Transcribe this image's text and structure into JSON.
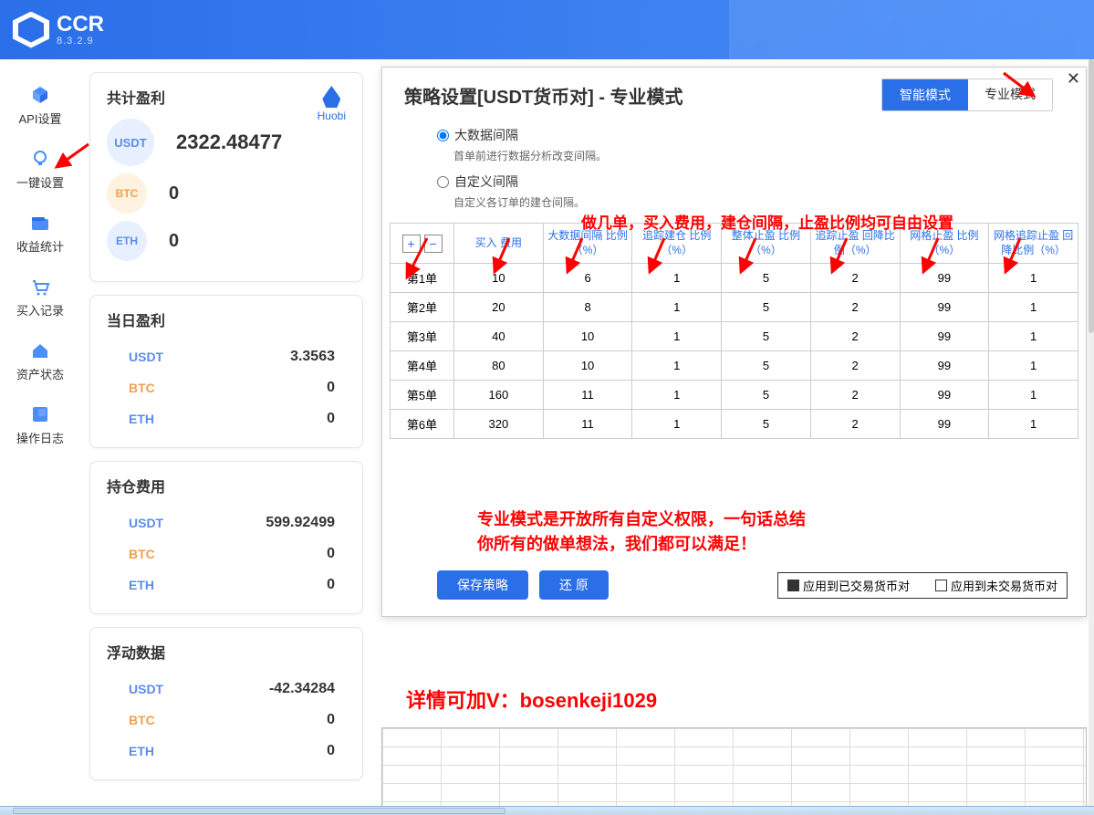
{
  "app": {
    "name": "CCR",
    "version": "8.3.2.9"
  },
  "sidebar": [
    {
      "label": "API设置",
      "icon": "api"
    },
    {
      "label": "一键设置",
      "icon": "bulb"
    },
    {
      "label": "收益统计",
      "icon": "folder"
    },
    {
      "label": "买入记录",
      "icon": "cart"
    },
    {
      "label": "资产状态",
      "icon": "home"
    },
    {
      "label": "操作日志",
      "icon": "list"
    }
  ],
  "exchange": "Huobi",
  "totals": {
    "title": "共计盈利",
    "rows": [
      {
        "coin": "USDT",
        "value": "2322.48477"
      },
      {
        "coin": "BTC",
        "value": "0"
      },
      {
        "coin": "ETH",
        "value": "0"
      }
    ]
  },
  "today": {
    "title": "当日盈利",
    "rows": [
      {
        "coin": "USDT",
        "value": "3.3563"
      },
      {
        "coin": "BTC",
        "value": "0"
      },
      {
        "coin": "ETH",
        "value": "0"
      }
    ]
  },
  "holding": {
    "title": "持仓费用",
    "rows": [
      {
        "coin": "USDT",
        "value": "599.92499"
      },
      {
        "coin": "BTC",
        "value": "0"
      },
      {
        "coin": "ETH",
        "value": "0"
      }
    ]
  },
  "floating": {
    "title": "浮动数据",
    "rows": [
      {
        "coin": "USDT",
        "value": "-42.34284"
      },
      {
        "coin": "BTC",
        "value": "0"
      },
      {
        "coin": "ETH",
        "value": "0"
      }
    ]
  },
  "dialog": {
    "title": "策略设置[USDT货币对] - 专业模式",
    "tabs": [
      "智能模式",
      "专业模式"
    ],
    "radio1": {
      "label": "大数据间隔",
      "desc": "首单前进行数据分析改变间隔。"
    },
    "radio2": {
      "label": "自定义间隔",
      "desc": "自定义各订单的建仓间隔。"
    },
    "headers": [
      "买入\n费用",
      "大数据间隔\n比例（%）",
      "追踪建仓\n比例（%）",
      "整体止盈\n比例（%）",
      "追踪止盈\n回降比例（%）",
      "网格止盈\n比例（%）",
      "网格追踪止盈\n回降比例（%）"
    ],
    "rows": [
      {
        "n": "第1单",
        "v": [
          "10",
          "6",
          "1",
          "5",
          "2",
          "99",
          "1"
        ]
      },
      {
        "n": "第2单",
        "v": [
          "20",
          "8",
          "1",
          "5",
          "2",
          "99",
          "1"
        ]
      },
      {
        "n": "第3单",
        "v": [
          "40",
          "10",
          "1",
          "5",
          "2",
          "99",
          "1"
        ]
      },
      {
        "n": "第4单",
        "v": [
          "80",
          "10",
          "1",
          "5",
          "2",
          "99",
          "1"
        ]
      },
      {
        "n": "第5单",
        "v": [
          "160",
          "11",
          "1",
          "5",
          "2",
          "99",
          "1"
        ]
      },
      {
        "n": "第6单",
        "v": [
          "320",
          "11",
          "1",
          "5",
          "2",
          "99",
          "1"
        ]
      }
    ],
    "save": "保存策略",
    "restore": "还  原",
    "apply1": "应用到已交易货币对",
    "apply2": "应用到未交易货币对"
  },
  "anno": {
    "a1": "做几单，买入费用，建仓间隔，止盈比例均可自由设置",
    "a2": "专业模式是开放所有自定义权限，一句话总结\n你所有的做单想法，我们都可以满足！",
    "a3": "详情可加V：bosenkeji1029"
  },
  "colors": {
    "usdt": "#5a8ee8",
    "btc": "#f0a050",
    "eth": "#5a8ee8",
    "red": "#ff0000",
    "primary": "#2a6fe8"
  }
}
